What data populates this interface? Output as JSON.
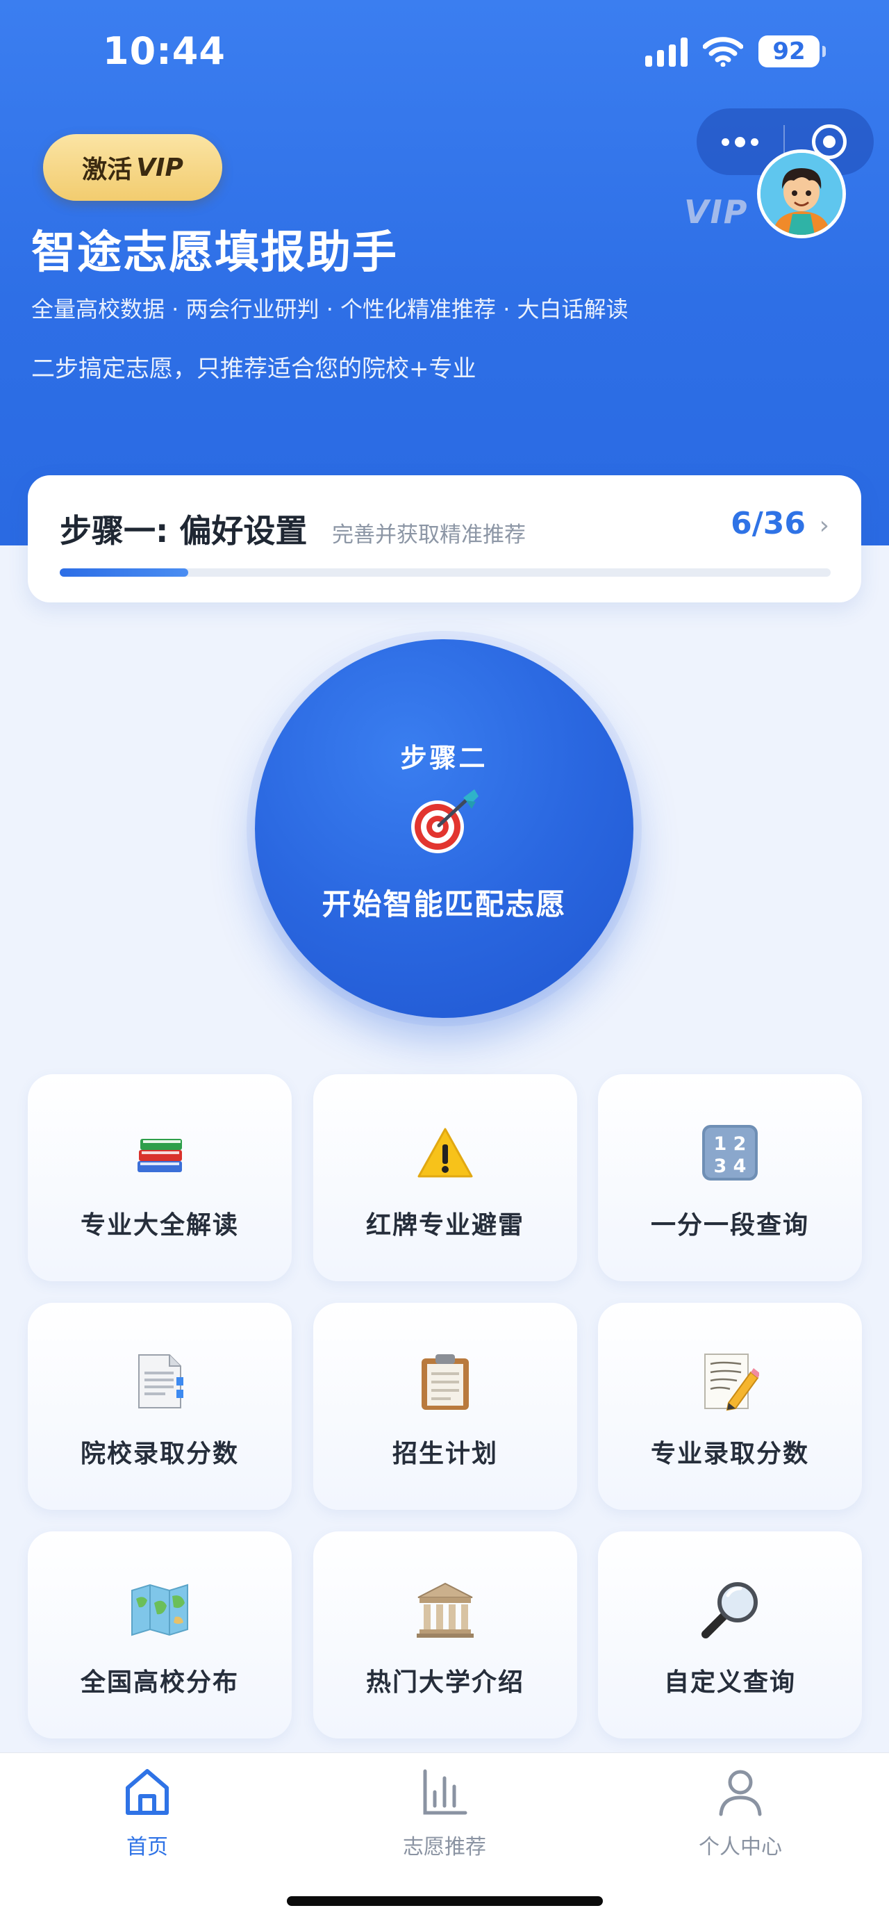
{
  "status_bar": {
    "time": "10:44",
    "battery": "92"
  },
  "header": {
    "vip_button": {
      "prefix": "激活",
      "suffix": "VIP"
    },
    "vip_tag": "VIP",
    "title": "智途志愿填报助手",
    "subtitle": "全量高校数据 · 两会行业研判 · 个性化精准推荐 · 大白话解读",
    "tagline": "二步搞定志愿，只推荐适合您的院校+专业"
  },
  "step1": {
    "title": "步骤一: 偏好设置",
    "subtitle": "完善并获取精准推荐",
    "progress_text": "6/36",
    "progress_value": 6,
    "progress_total": 36
  },
  "step2": {
    "step_label": "步骤二",
    "action_label": "开始智能匹配志愿"
  },
  "grid": [
    {
      "label": "专业大全解读",
      "icon": "books-icon"
    },
    {
      "label": "红牌专业避雷",
      "icon": "warning-icon"
    },
    {
      "label": "一分一段查询",
      "icon": "numbers-icon"
    },
    {
      "label": "院校录取分数",
      "icon": "document-icon"
    },
    {
      "label": "招生计划",
      "icon": "clipboard-icon"
    },
    {
      "label": "专业录取分数",
      "icon": "memo-pencil-icon"
    },
    {
      "label": "全国高校分布",
      "icon": "map-icon"
    },
    {
      "label": "热门大学介绍",
      "icon": "classical-building-icon"
    },
    {
      "label": "自定义查询",
      "icon": "magnifier-icon"
    }
  ],
  "tabbar": {
    "items": [
      {
        "label": "首页",
        "active": true
      },
      {
        "label": "志愿推荐",
        "active": false
      },
      {
        "label": "个人中心",
        "active": false
      }
    ]
  },
  "colors": {
    "primary": "#2f73e6",
    "inactive": "#8a93a2"
  }
}
